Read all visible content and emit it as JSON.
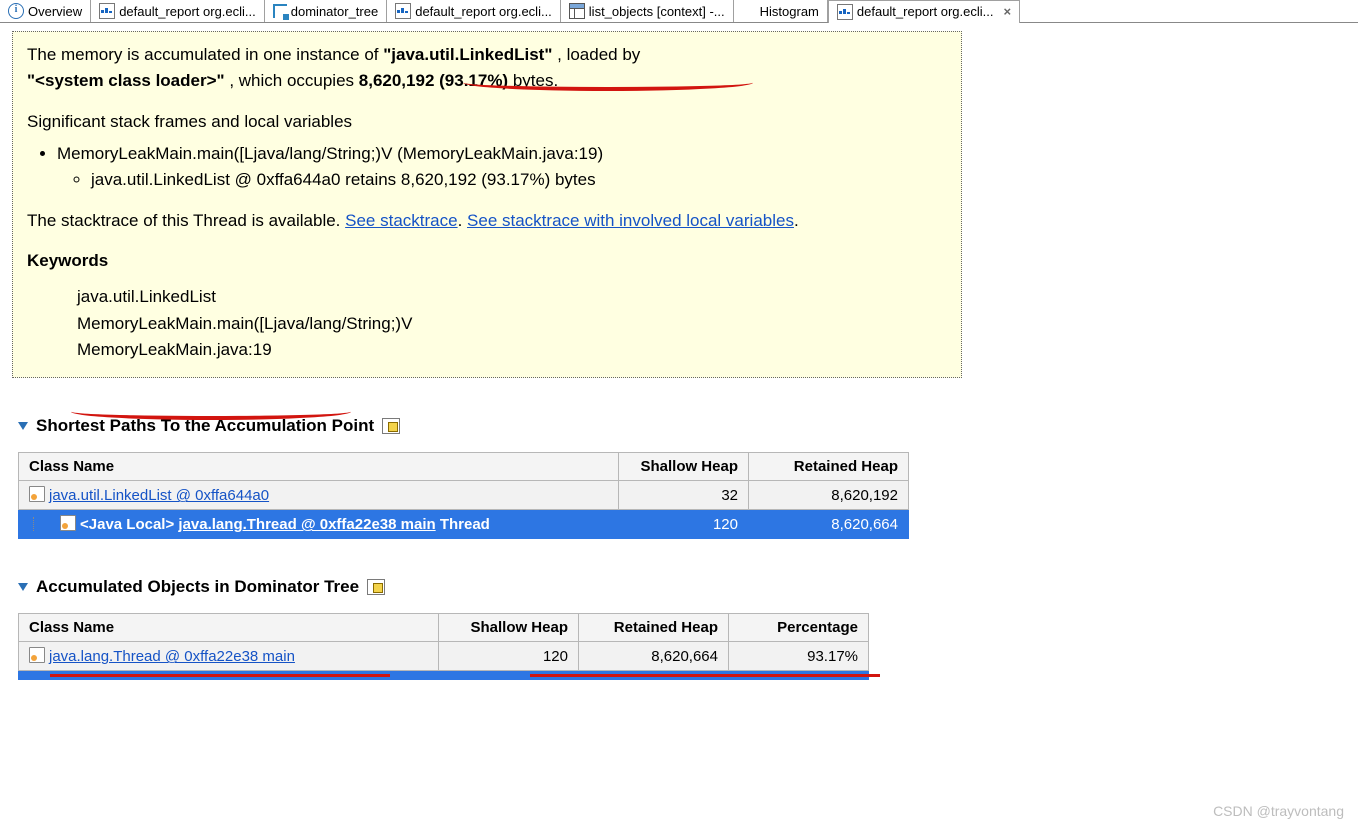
{
  "tabs": [
    {
      "label": "Overview",
      "icon": "info-icon"
    },
    {
      "label": "default_report org.ecli...",
      "icon": "report-icon"
    },
    {
      "label": "dominator_tree",
      "icon": "tree-icon"
    },
    {
      "label": "default_report org.ecli...",
      "icon": "report-icon"
    },
    {
      "label": "list_objects [context] -...",
      "icon": "table-icon"
    },
    {
      "label": "Histogram",
      "icon": "histogram-icon"
    },
    {
      "label": "default_report org.ecli...",
      "icon": "report-icon",
      "active": true
    }
  ],
  "panel": {
    "intro1": "The memory is accumulated in one instance of ",
    "class": "\"java.util.LinkedList\"",
    "intro2": ", loaded by ",
    "loader": "\"<system class loader>\"",
    "intro3": ", which occupies ",
    "size": "8,620,192 (93.17%)",
    "intro4": " bytes.",
    "stackHeading": "Significant stack frames and local variables",
    "frame1": "MemoryLeakMain.main([Ljava/lang/String;)V (MemoryLeakMain.java:19)",
    "frame2": "java.util.LinkedList @ 0xffa644a0 retains 8,620,192 (93.17%) bytes",
    "trace1": "The stacktrace of this Thread is available. ",
    "link1": "See stacktrace",
    "trace2": ". ",
    "link2": "See stacktrace with involved local variables",
    "trace3": ".",
    "kwHeading": "Keywords",
    "kw1": "java.util.LinkedList",
    "kw2": "MemoryLeakMain.main([Ljava/lang/String;)V",
    "kw3": "MemoryLeakMain.java:19"
  },
  "sect1": "Shortest Paths To the Accumulation Point",
  "table1": {
    "cols": [
      "Class Name",
      "Shallow Heap",
      "Retained Heap"
    ],
    "colw": [
      "600px",
      "130px",
      "160px"
    ],
    "rows": [
      {
        "link": "java.util.LinkedList @ 0xffa644a0",
        "shallow": "32",
        "retained": "8,620,192"
      },
      {
        "prefix": "<Java Local> ",
        "link": "java.lang.Thread @ 0xffa22e38 main",
        "suffix": " Thread",
        "shallow": "120",
        "retained": "8,620,664",
        "selected": true
      }
    ]
  },
  "sect2": "Accumulated Objects in Dominator Tree",
  "table2": {
    "cols": [
      "Class Name",
      "Shallow Heap",
      "Retained Heap",
      "Percentage"
    ],
    "colw": [
      "420px",
      "140px",
      "150px",
      "140px"
    ],
    "rows": [
      {
        "link": "java.lang.Thread @ 0xffa22e38 main",
        "shallow": "120",
        "retained": "8,620,664",
        "pct": "93.17%"
      }
    ]
  },
  "watermark": "CSDN @trayvontang"
}
